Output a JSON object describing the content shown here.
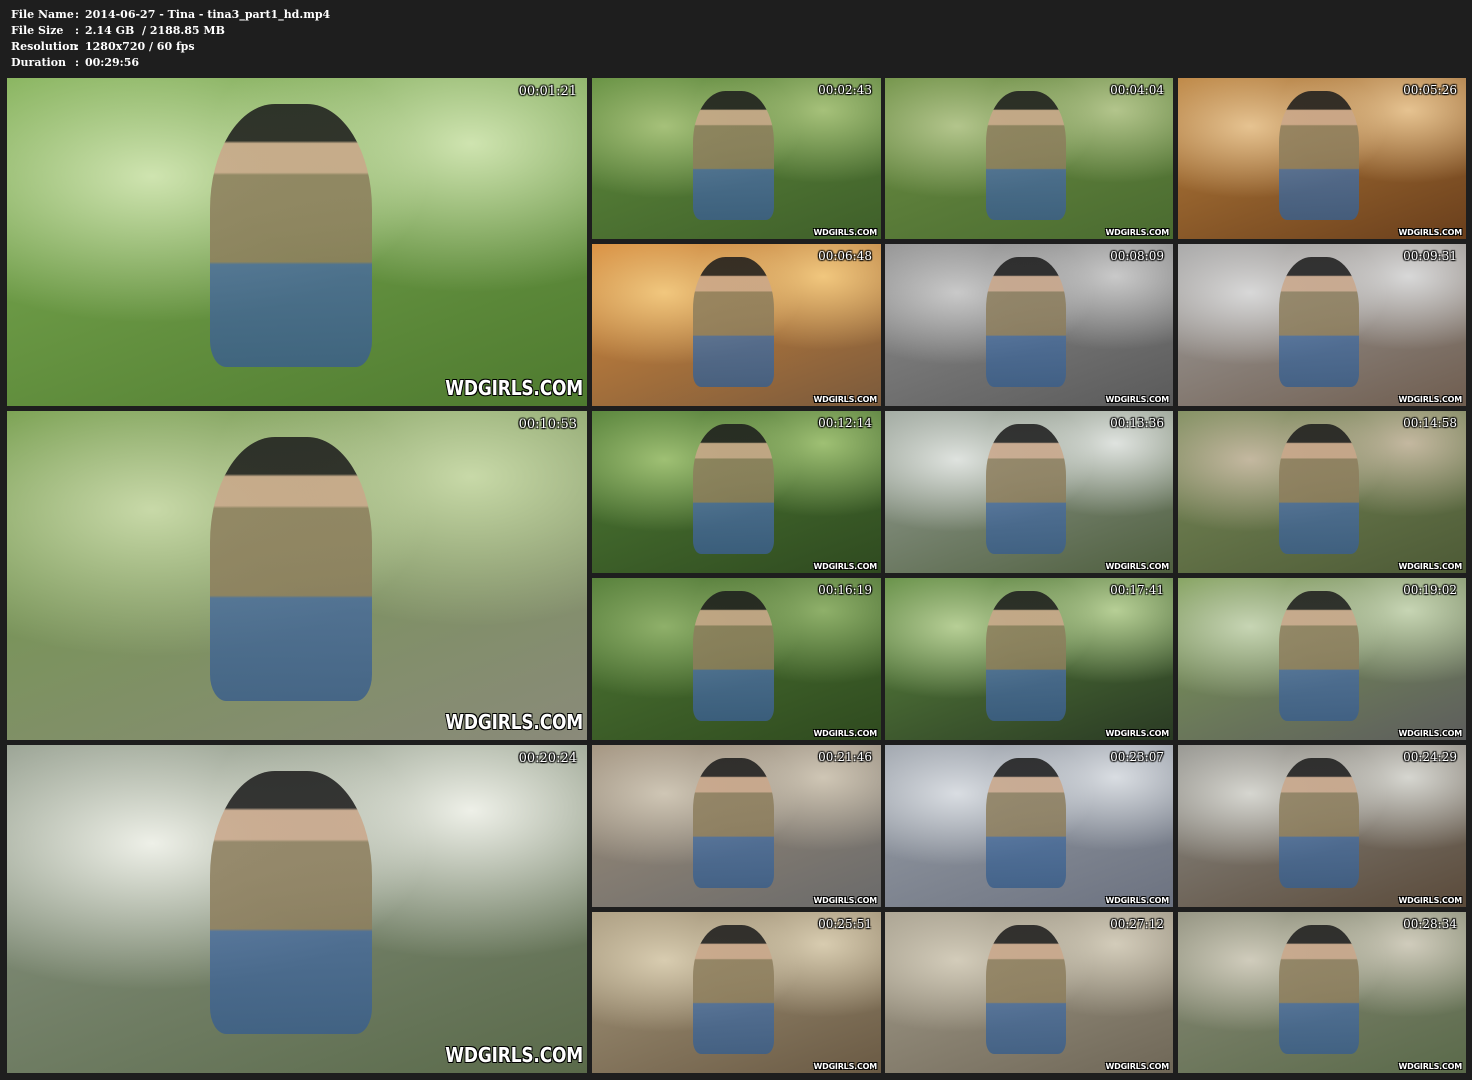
{
  "info": {
    "rows": [
      {
        "label": "File Name",
        "sep": ":",
        "value": "2014-06-27 - Tina - tina3_part1_hd.mp4"
      },
      {
        "label": "File Size",
        "sep": ":",
        "value": "2.14 GB  / 2188.85 MB"
      },
      {
        "label": "Resolution",
        "sep": ":",
        "value": "1280x720 / 60 fps"
      },
      {
        "label": "Duration",
        "sep": ":",
        "value": "00:29:56"
      }
    ]
  },
  "watermark": "WDGIRLS.COM",
  "thumbnails": [
    {
      "timestamp": "00:01:21",
      "scene": "park-trees",
      "palette": [
        "#7fae54",
        "#cfe4b0",
        "#4e7a2f"
      ]
    },
    {
      "timestamp": "00:02:43",
      "scene": "grass-sitting",
      "palette": [
        "#5f8c3c",
        "#a6c17a",
        "#3f5f2a"
      ]
    },
    {
      "timestamp": "00:04:04",
      "scene": "grass-crouching",
      "palette": [
        "#6c8f43",
        "#b3c58c",
        "#4a6b30"
      ]
    },
    {
      "timestamp": "00:05:26",
      "scene": "tram-drinking",
      "palette": [
        "#b9803c",
        "#e6c391",
        "#6a3f1c"
      ]
    },
    {
      "timestamp": "00:06:48",
      "scene": "tram-interior",
      "palette": [
        "#d88a3a",
        "#f1c77e",
        "#7a5a3c"
      ]
    },
    {
      "timestamp": "00:08:09",
      "scene": "street-bench",
      "palette": [
        "#8f8f8f",
        "#c9c9c9",
        "#5a5a5a"
      ]
    },
    {
      "timestamp": "00:09:31",
      "scene": "city-street",
      "palette": [
        "#a3a3a3",
        "#d8d8d8",
        "#6f5d4f"
      ]
    },
    {
      "timestamp": "00:10:53",
      "scene": "stairs-park",
      "palette": [
        "#6f9a46",
        "#c8d9a8",
        "#8a8a7a"
      ]
    },
    {
      "timestamp": "00:12:14",
      "scene": "bottle-trees",
      "palette": [
        "#4f7d34",
        "#9fc074",
        "#2f4a20"
      ]
    },
    {
      "timestamp": "00:13:36",
      "scene": "railing-bending",
      "palette": [
        "#9aa39a",
        "#dfe3df",
        "#4f5f3f"
      ]
    },
    {
      "timestamp": "00:14:58",
      "scene": "path-crouch",
      "palette": [
        "#7a8c5a",
        "#c4b8a0",
        "#4d5a36"
      ]
    },
    {
      "timestamp": "00:16:19",
      "scene": "grass-kneel",
      "palette": [
        "#4f7a34",
        "#8fb06a",
        "#2f4a1f"
      ]
    },
    {
      "timestamp": "00:17:41",
      "scene": "closeup-bottle",
      "palette": [
        "#5d8a3e",
        "#b7cf96",
        "#2a3a24"
      ]
    },
    {
      "timestamp": "00:19:02",
      "scene": "path-walk",
      "palette": [
        "#7d9d55",
        "#c7d5b4",
        "#5d5d5d"
      ]
    },
    {
      "timestamp": "00:20:24",
      "scene": "stairs-railing",
      "palette": [
        "#8e9888",
        "#eef0e8",
        "#5a6a4a"
      ]
    },
    {
      "timestamp": "00:21:46",
      "scene": "railing-sidewalk",
      "palette": [
        "#9f8f7a",
        "#cfc6b5",
        "#6a6a6a"
      ]
    },
    {
      "timestamp": "00:23:07",
      "scene": "street-building",
      "palette": [
        "#9aa0a8",
        "#d9dde2",
        "#6c7280"
      ]
    },
    {
      "timestamp": "00:24:29",
      "scene": "street-hug",
      "palette": [
        "#8f8f8a",
        "#d6d6d0",
        "#5a4a3a"
      ]
    },
    {
      "timestamp": "00:25:51",
      "scene": "wall-sunglasses",
      "palette": [
        "#a89a7e",
        "#d8ccb0",
        "#6a5a44"
      ]
    },
    {
      "timestamp": "00:27:12",
      "scene": "stone-wall",
      "palette": [
        "#a7a08f",
        "#d3ccba",
        "#6f6757"
      ]
    },
    {
      "timestamp": "00:28:34",
      "scene": "cafe-terrace",
      "palette": [
        "#8c8c7a",
        "#d0ccbc",
        "#5a6a4a"
      ]
    }
  ]
}
